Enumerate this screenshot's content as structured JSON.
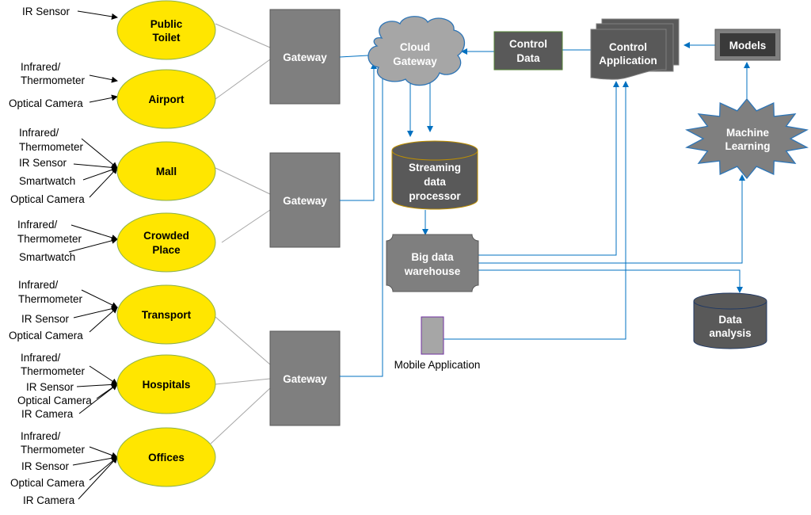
{
  "locations": [
    {
      "lines": [
        "Public",
        "Toilet"
      ],
      "sensors": [
        "IR Sensor"
      ]
    },
    {
      "lines": [
        "Airport"
      ],
      "sensors": [
        "Infrared/",
        "Thermometer",
        "Optical Camera"
      ]
    },
    {
      "lines": [
        "Mall"
      ],
      "sensors": [
        "Infrared/",
        "Thermometer",
        "IR Sensor",
        "Smartwatch",
        "Optical Camera"
      ]
    },
    {
      "lines": [
        "Crowded",
        "Place"
      ],
      "sensors": [
        "Infrared/",
        "Thermometer",
        "Smartwatch"
      ]
    },
    {
      "lines": [
        "Transport"
      ],
      "sensors": [
        "Infrared/",
        "Thermometer",
        "IR Sensor",
        "Optical Camera"
      ]
    },
    {
      "lines": [
        "Hospitals"
      ],
      "sensors": [
        "Infrared/",
        "Thermometer",
        "IR Sensor",
        "Optical Camera",
        "IR Camera"
      ]
    },
    {
      "lines": [
        "Offices"
      ],
      "sensors": [
        "Infrared/",
        "Thermometer",
        "IR Sensor",
        "Optical Camera",
        "IR Camera"
      ]
    }
  ],
  "gateways": [
    "Gateway",
    "Gateway",
    "Gateway"
  ],
  "cloud_gateway": [
    "Cloud",
    "Gateway"
  ],
  "control_data": [
    "Control",
    "Data"
  ],
  "control_application": [
    "Control",
    "Application"
  ],
  "models": "Models",
  "machine_learning": [
    "Machine",
    "Learning"
  ],
  "streaming": [
    "Streaming",
    "data",
    "processor"
  ],
  "big_data": [
    "Big data",
    "warehouse"
  ],
  "data_analysis": [
    "Data",
    "analysis"
  ],
  "mobile_application": "Mobile Application",
  "colors": {
    "location_fill": "#ffe600",
    "gateway_fill": "#7f7f7f",
    "dark_node": "#595959",
    "connector": "#0070c0"
  }
}
